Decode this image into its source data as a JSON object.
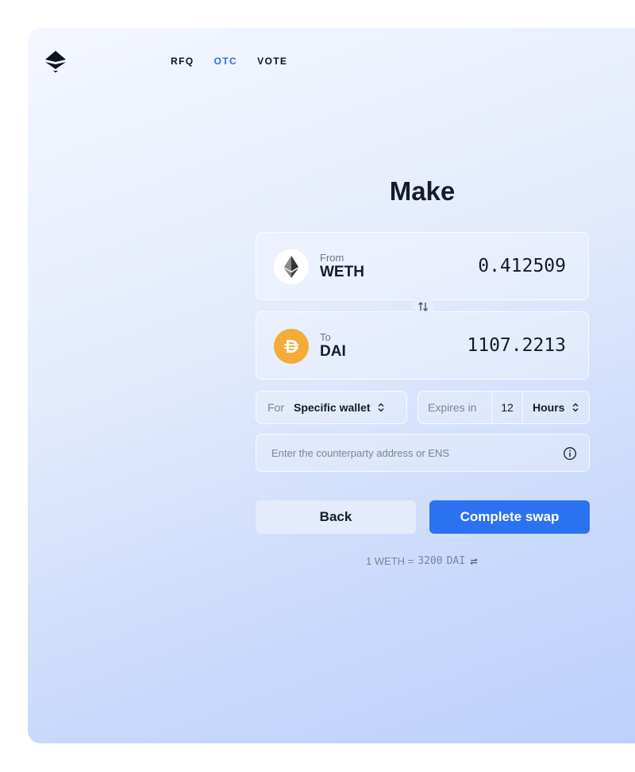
{
  "nav": {
    "items": [
      {
        "label": "RFQ",
        "active": false
      },
      {
        "label": "OTC",
        "active": true
      },
      {
        "label": "VOTE",
        "active": false
      }
    ]
  },
  "main": {
    "title": "Make",
    "from": {
      "direction": "From",
      "symbol": "WETH",
      "amount": "0.412509",
      "icon": "ethereum-icon"
    },
    "to": {
      "direction": "To",
      "symbol": "DAI",
      "amount": "1107.2213",
      "icon": "dai-icon"
    },
    "counterparty": {
      "label": "For",
      "value": "Specific wallet"
    },
    "expiry": {
      "label": "Expires in",
      "amount": "12",
      "unit": "Hours"
    },
    "address": {
      "placeholder": "Enter the counterparty address or ENS",
      "value": ""
    },
    "buttons": {
      "back": "Back",
      "complete": "Complete swap"
    },
    "rate": {
      "base": "1 WETH =",
      "value": "3200",
      "quote": "DAI"
    }
  },
  "colors": {
    "accent": "#2b72f0",
    "active_nav": "#2b6fe6",
    "dai": "#f5ac37",
    "text": "#151b2b"
  }
}
